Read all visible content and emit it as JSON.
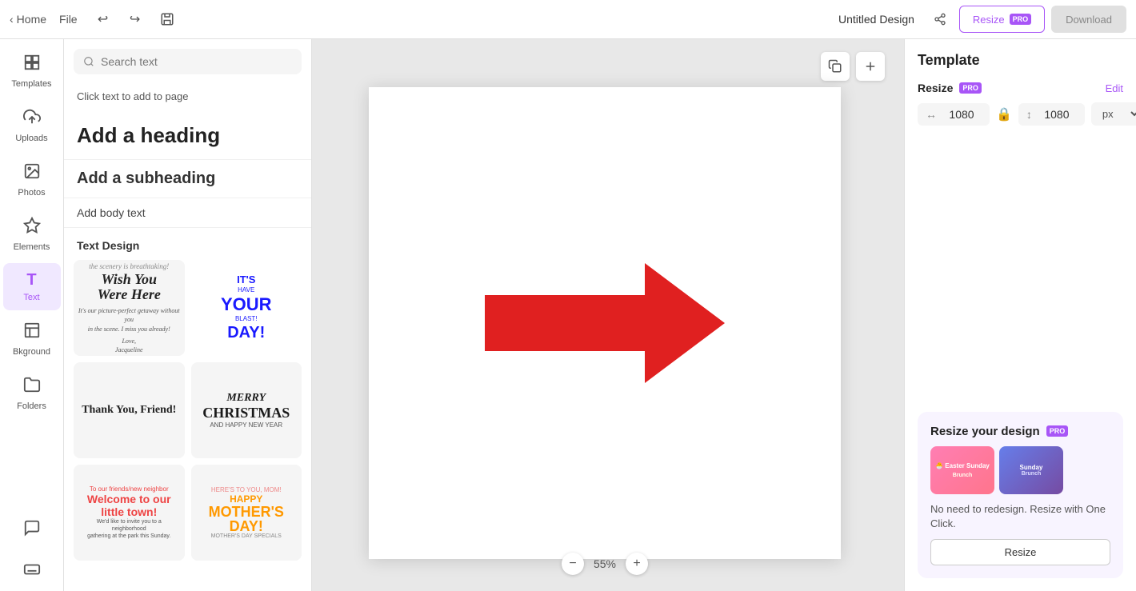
{
  "topbar": {
    "home_label": "Home",
    "file_label": "File",
    "design_title": "Untitled Design",
    "resize_label": "Resize",
    "download_label": "Download",
    "pro_badge": "PRO"
  },
  "sidebar": {
    "items": [
      {
        "id": "templates",
        "label": "Templates",
        "icon": "⊞"
      },
      {
        "id": "uploads",
        "label": "Uploads",
        "icon": "☁"
      },
      {
        "id": "photos",
        "label": "Photos",
        "icon": "🖼"
      },
      {
        "id": "elements",
        "label": "Elements",
        "icon": "✦"
      },
      {
        "id": "text",
        "label": "Text",
        "icon": "T"
      },
      {
        "id": "background",
        "label": "Bkground",
        "icon": "▦"
      },
      {
        "id": "folders",
        "label": "Folders",
        "icon": "📁"
      },
      {
        "id": "chat",
        "label": "",
        "icon": "💬"
      },
      {
        "id": "keyboard",
        "label": "",
        "icon": "⌨"
      }
    ]
  },
  "panel": {
    "search_placeholder": "Search text",
    "click_to_add": "Click text to add to page",
    "add_heading": "Add a heading",
    "add_subheading": "Add a subheading",
    "add_body": "Add body text",
    "text_design_label": "Text Design"
  },
  "canvas": {
    "zoom_level": "55%"
  },
  "right_panel": {
    "template_title": "Template",
    "resize_label": "Resize",
    "pro_badge": "PRO",
    "edit_label": "Edit",
    "width_value": "1080",
    "height_value": "1080",
    "unit": "px",
    "resize_promo_title": "Resize your design",
    "resize_promo_pro": "PRO",
    "resize_promo_desc": "No need to redesign. Resize with One Click.",
    "resize_promo_btn": "Resize"
  }
}
